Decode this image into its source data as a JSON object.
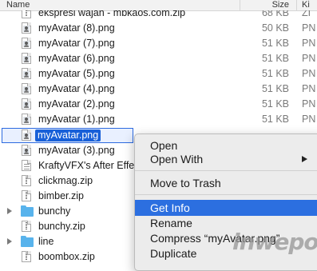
{
  "header": {
    "name_label": "Name",
    "size_label": "Size",
    "kind_label": "Ki"
  },
  "files": [
    {
      "name": "ekspresi wajah - mbkaos.com.zip",
      "size": "68 KB",
      "kind": "ZI",
      "type": "zip"
    },
    {
      "name": "myAvatar (8).png",
      "size": "50 KB",
      "kind": "PN",
      "type": "png"
    },
    {
      "name": "myAvatar (7).png",
      "size": "51 KB",
      "kind": "PN",
      "type": "png"
    },
    {
      "name": "myAvatar (6).png",
      "size": "51 KB",
      "kind": "PN",
      "type": "png"
    },
    {
      "name": "myAvatar (5).png",
      "size": "51 KB",
      "kind": "PN",
      "type": "png"
    },
    {
      "name": "myAvatar (4).png",
      "size": "51 KB",
      "kind": "PN",
      "type": "png"
    },
    {
      "name": "myAvatar (2).png",
      "size": "51 KB",
      "kind": "PN",
      "type": "png"
    },
    {
      "name": "myAvatar (1).png",
      "size": "51 KB",
      "kind": "PN",
      "type": "png"
    },
    {
      "name": "myAvatar.png",
      "size": "",
      "kind": "",
      "type": "png",
      "selected": true
    },
    {
      "name": "myAvatar (3).png",
      "size": "",
      "kind": "",
      "type": "png"
    },
    {
      "name": "KraftyVFX's After Effe",
      "size": "",
      "kind": "",
      "type": "pdf"
    },
    {
      "name": "clickmag.zip",
      "size": "",
      "kind": "",
      "type": "zip"
    },
    {
      "name": "bimber.zip",
      "size": "",
      "kind": "",
      "type": "zip"
    },
    {
      "name": "bunchy",
      "size": "",
      "kind": "",
      "type": "folder"
    },
    {
      "name": "bunchy.zip",
      "size": "",
      "kind": "",
      "type": "zip"
    },
    {
      "name": "line",
      "size": "",
      "kind": "",
      "type": "folder"
    },
    {
      "name": "boombox.zip",
      "size": "",
      "kind": "",
      "type": "zip"
    }
  ],
  "context_menu": {
    "open": "Open",
    "open_with": "Open With",
    "move_to_trash": "Move to Trash",
    "get_info": "Get Info",
    "rename": "Rename",
    "compress": "Compress “myAvatar.png”",
    "duplicate": "Duplicate"
  },
  "watermark": "inwepo",
  "colors": {
    "selection_blue": "#1860d8",
    "menu_highlight": "#2c6fe0",
    "folder_blue": "#58b3ec"
  }
}
